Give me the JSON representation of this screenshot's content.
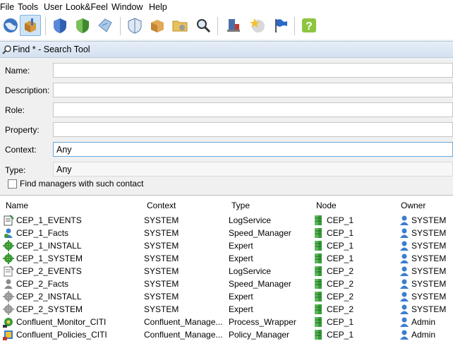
{
  "menu": [
    "File",
    "Tools",
    "User",
    "Look&Feel",
    "Window",
    "Help"
  ],
  "toolbar_icons": [
    "globe-icon",
    "box-tool-icon",
    "shield-blue-icon",
    "shield-green-icon",
    "tag-icon",
    "shield-check-icon",
    "package-icon",
    "folder-gear-icon",
    "magnifier-icon",
    "server-icon",
    "star-icon",
    "flag-icon",
    "help-icon"
  ],
  "window_title": "Find * - Search Tool",
  "form": {
    "name_label": "Name:",
    "name_value": "",
    "description_label": "Description:",
    "description_value": "",
    "role_label": "Role:",
    "role_value": "",
    "property_label": "Property:",
    "property_value": "",
    "context_label": "Context:",
    "context_value": "Any",
    "type_label": "Type:",
    "type_value": "Any",
    "checkbox_label": "Find managers with such contact",
    "checkbox_checked": false
  },
  "table": {
    "headers": [
      "Name",
      "Context",
      "Type",
      "Node",
      "Owner"
    ],
    "rows": [
      {
        "name": "CEP_1_EVENTS",
        "context": "SYSTEM",
        "type": "LogService",
        "node": "CEP_1",
        "owner": "SYSTEM",
        "icon": "log-icon"
      },
      {
        "name": "CEP_1_Facts",
        "context": "SYSTEM",
        "type": "Speed_Manager",
        "node": "CEP_1",
        "owner": "SYSTEM",
        "icon": "person-blue-icon"
      },
      {
        "name": "CEP_1_INSTALL",
        "context": "SYSTEM",
        "type": "Expert",
        "node": "CEP_1",
        "owner": "SYSTEM",
        "icon": "gear-green-icon"
      },
      {
        "name": "CEP_1_SYSTEM",
        "context": "SYSTEM",
        "type": "Expert",
        "node": "CEP_1",
        "owner": "SYSTEM",
        "icon": "gear-green-icon"
      },
      {
        "name": "CEP_2_EVENTS",
        "context": "SYSTEM",
        "type": "LogService",
        "node": "CEP_2",
        "owner": "SYSTEM",
        "icon": "log-gray-icon"
      },
      {
        "name": "CEP_2_Facts",
        "context": "SYSTEM",
        "type": "Speed_Manager",
        "node": "CEP_2",
        "owner": "SYSTEM",
        "icon": "person-gray-icon"
      },
      {
        "name": "CEP_2_INSTALL",
        "context": "SYSTEM",
        "type": "Expert",
        "node": "CEP_2",
        "owner": "SYSTEM",
        "icon": "gear-gray-icon"
      },
      {
        "name": "CEP_2_SYSTEM",
        "context": "SYSTEM",
        "type": "Expert",
        "node": "CEP_2",
        "owner": "SYSTEM",
        "icon": "gear-gray-icon"
      },
      {
        "name": "Confluent_Monitor_CITI",
        "context": "Confluent_Manage...",
        "type": "Process_Wrapper",
        "node": "CEP_1",
        "owner": "Admin",
        "icon": "monitor-icon"
      },
      {
        "name": "Confluent_Policies_CITI",
        "context": "Confluent_Manage...",
        "type": "Policy_Manager",
        "node": "CEP_1",
        "owner": "Admin",
        "icon": "policy-icon"
      }
    ]
  },
  "colors": {
    "selection_border": "#6aa7da",
    "titlebar": "#d4e1f0",
    "node_icon_green": "#3a9a3a",
    "owner_icon_blue": "#3c7dd0"
  }
}
